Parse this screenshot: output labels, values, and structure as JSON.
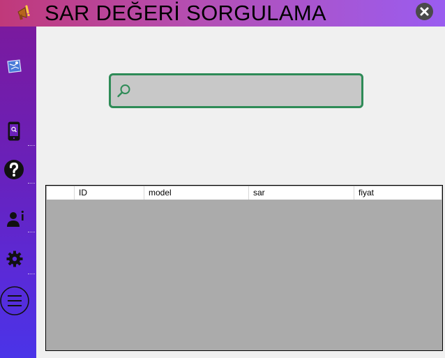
{
  "window": {
    "title": "SAR DEĞERİ SORGULAMA",
    "accent": "#2e8b57",
    "app_icon": "megaphone-icon",
    "close_icon": "close-icon"
  },
  "sidebar": {
    "items": [
      {
        "icon": "map-icon"
      },
      {
        "icon": "phone-search-icon"
      },
      {
        "icon": "help-icon"
      },
      {
        "icon": "user-info-icon"
      },
      {
        "icon": "settings-icon"
      },
      {
        "icon": "menu-icon"
      }
    ]
  },
  "search": {
    "icon": "search-icon",
    "value": "",
    "placeholder": ""
  },
  "table": {
    "columns": [
      "",
      "ID",
      "model",
      "sar",
      "fiyat"
    ],
    "rows": []
  }
}
